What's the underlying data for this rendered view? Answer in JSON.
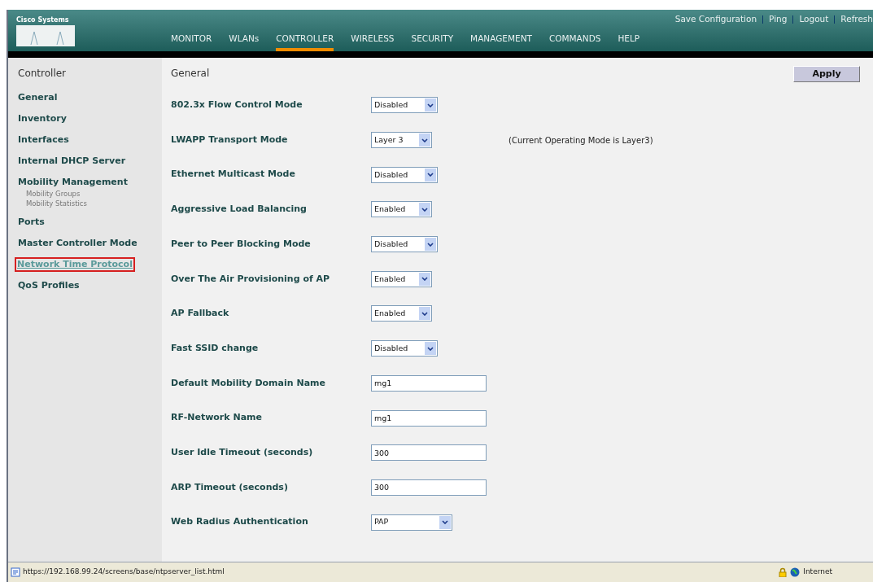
{
  "header": {
    "logo_text": "Cisco Systems",
    "top_links": [
      "Save Configuration",
      "Ping",
      "Logout",
      "Refresh"
    ],
    "menu": [
      {
        "label": "MONITOR",
        "selected": false
      },
      {
        "label": "WLANs",
        "selected": false
      },
      {
        "label": "CONTROLLER",
        "selected": true
      },
      {
        "label": "WIRELESS",
        "selected": false
      },
      {
        "label": "SECURITY",
        "selected": false
      },
      {
        "label": "MANAGEMENT",
        "selected": false
      },
      {
        "label": "COMMANDS",
        "selected": false
      },
      {
        "label": "HELP",
        "selected": false
      }
    ]
  },
  "sidebar": {
    "title": "Controller",
    "items": [
      {
        "label": "General",
        "highlighted": false
      },
      {
        "label": "Inventory",
        "highlighted": false
      },
      {
        "label": "Interfaces",
        "highlighted": false
      },
      {
        "label": "Internal DHCP Server",
        "highlighted": false
      },
      {
        "label": "Mobility Management",
        "highlighted": false,
        "children": [
          {
            "label": "Mobility Groups"
          },
          {
            "label": "Mobility Statistics"
          }
        ]
      },
      {
        "label": "Ports",
        "highlighted": false
      },
      {
        "label": "Master Controller Mode",
        "highlighted": false
      },
      {
        "label": "Network Time Protocol",
        "highlighted": true
      },
      {
        "label": "QoS Profiles",
        "highlighted": false
      }
    ]
  },
  "main": {
    "title": "General",
    "apply_button": "Apply",
    "settings": [
      {
        "kind": "select",
        "label": "802.3x Flow Control Mode",
        "value": "Disabled"
      },
      {
        "kind": "select",
        "label": "LWAPP Transport Mode",
        "value": "Layer 3",
        "note": "(Current Operating Mode is Layer3)"
      },
      {
        "kind": "select",
        "label": "Ethernet Multicast Mode",
        "value": "Disabled"
      },
      {
        "kind": "select",
        "label": "Aggressive Load Balancing",
        "value": "Enabled"
      },
      {
        "kind": "select",
        "label": "Peer to Peer Blocking Mode",
        "value": "Disabled"
      },
      {
        "kind": "select",
        "label": "Over The Air Provisioning of AP",
        "value": "Enabled"
      },
      {
        "kind": "select",
        "label": "AP Fallback",
        "value": "Enabled"
      },
      {
        "kind": "select",
        "label": "Fast SSID change",
        "value": "Disabled"
      },
      {
        "kind": "text",
        "label": "Default Mobility Domain Name",
        "value": "mg1"
      },
      {
        "kind": "text",
        "label": "RF-Network Name",
        "value": "mg1"
      },
      {
        "kind": "text",
        "label": "User Idle Timeout (seconds)",
        "value": "300"
      },
      {
        "kind": "text",
        "label": "ARP Timeout (seconds)",
        "value": "300"
      },
      {
        "kind": "select",
        "label": "Web Radius Authentication",
        "value": "PAP",
        "wide": true
      }
    ]
  },
  "status_bar": {
    "url": "https://192.168.99.24/screens/base/ntpserver_list.html",
    "zone": "Internet"
  }
}
